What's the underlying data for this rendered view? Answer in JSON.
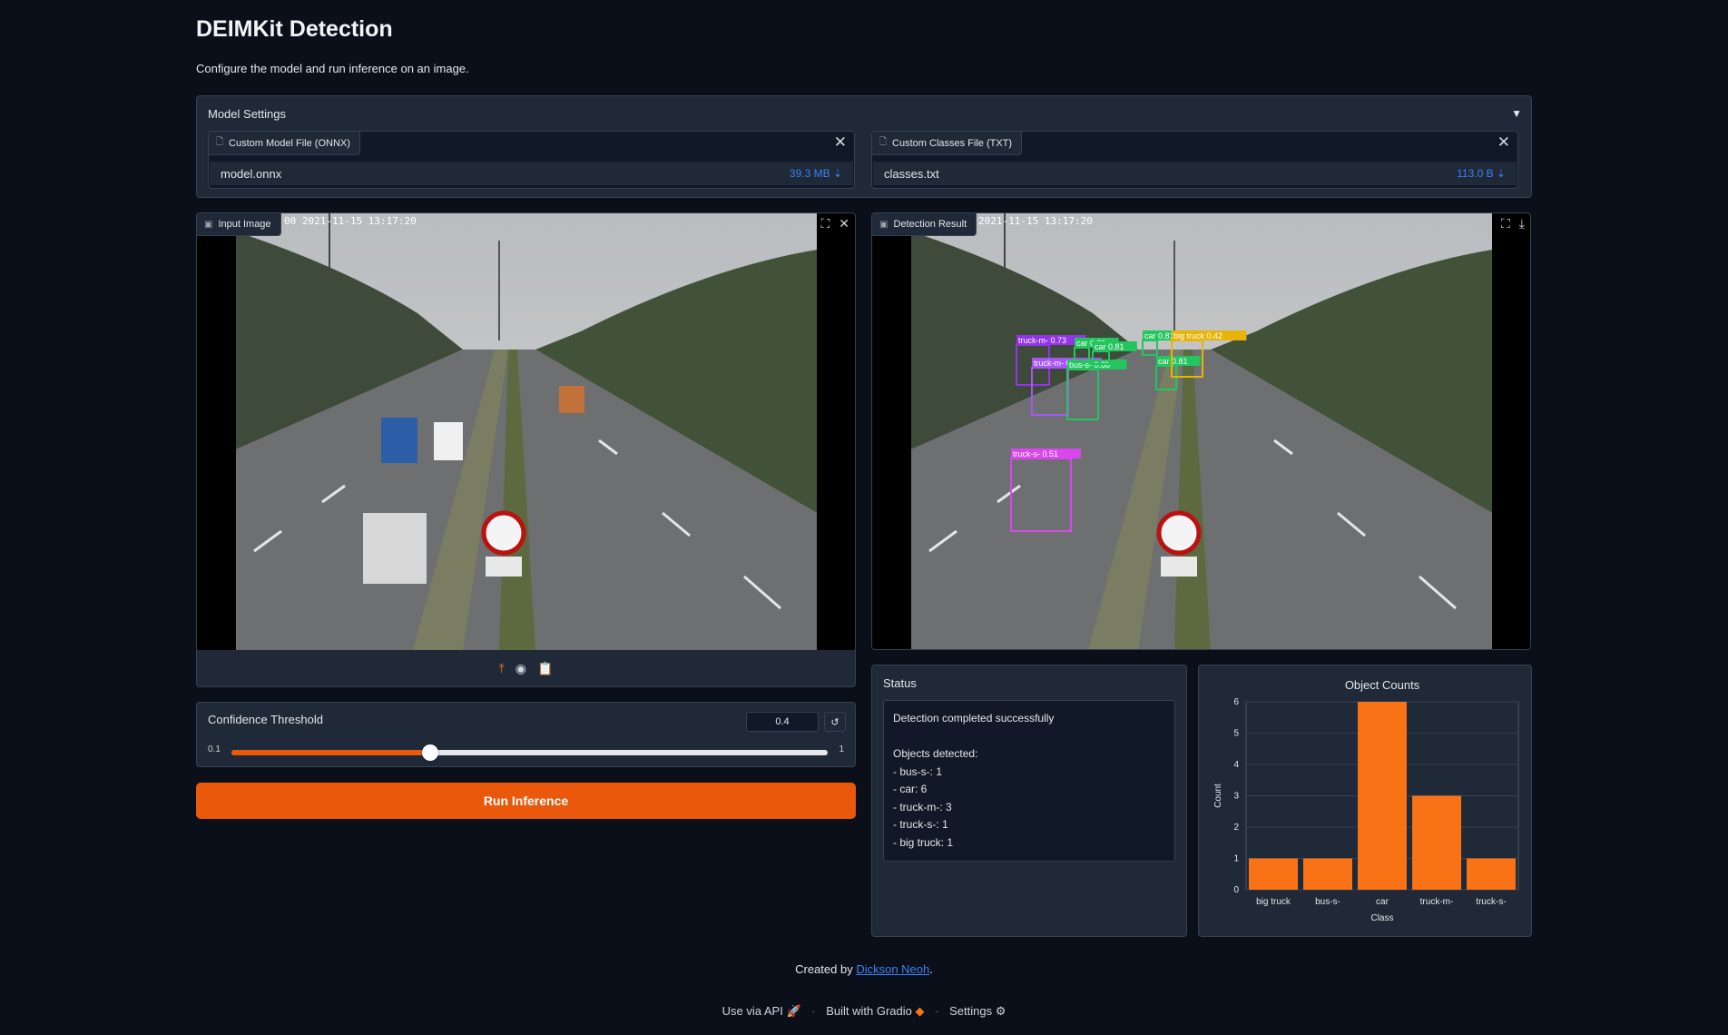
{
  "page": {
    "title": "DEIMKit Detection",
    "subtitle": "Configure the model and run inference on an image."
  },
  "model_settings": {
    "title": "Model Settings",
    "toggle_icon": "▼",
    "model_file": {
      "label": "Custom Model File (ONNX)",
      "name": "model.onnx",
      "size": "39.3 MB ⇣"
    },
    "classes_file": {
      "label": "Custom Classes File (TXT)",
      "name": "classes.txt",
      "size": "113.0 B ⇣"
    }
  },
  "input_image": {
    "label": "Input Image",
    "timestamp": "00 2021-11-15 13:17:20",
    "tools": [
      "fullscreen-icon",
      "close-icon"
    ],
    "sources": [
      "upload-icon",
      "webcam-icon",
      "clipboard-icon"
    ]
  },
  "result_image": {
    "label": "Detection Result",
    "timestamp": "2021-11-15 13:17:20",
    "tools": [
      "fullscreen-icon",
      "download-icon"
    ],
    "detections": [
      {
        "label": "truck-m- 0.73",
        "color": "#9333ea"
      },
      {
        "label": "truck-m- 0.73",
        "color": "#a855f7"
      },
      {
        "label": "bus-s- 0.88",
        "color": "#22c55e"
      },
      {
        "label": "car 0.81",
        "color": "#22c55e"
      },
      {
        "label": "car 0.81",
        "color": "#22c55e"
      },
      {
        "label": "car 0.81",
        "color": "#22c55e"
      },
      {
        "label": "car 0.81",
        "color": "#22c55e"
      },
      {
        "label": "big truck 0.42",
        "color": "#eab308"
      },
      {
        "label": "truck-s- 0.51",
        "color": "#d946ef"
      }
    ]
  },
  "threshold": {
    "label": "Confidence Threshold",
    "value": "0.4",
    "min": "0.1",
    "max": "1",
    "fraction": 0.333,
    "reset_icon": "↺"
  },
  "run_button": {
    "label": "Run Inference",
    "color": "#ea580c"
  },
  "status": {
    "label": "Status",
    "lines": [
      "Detection completed successfully",
      "",
      "Objects detected:",
      "- bus-s-: 1",
      "- car: 6",
      "- truck-m-: 3",
      "- truck-s-: 1",
      "- big truck: 1"
    ]
  },
  "chart_data": {
    "type": "bar",
    "title": "Object Counts",
    "xlabel": "Class",
    "ylabel": "Count",
    "categories": [
      "big truck",
      "bus-s-",
      "car",
      "truck-m-",
      "truck-s-"
    ],
    "values": [
      1,
      1,
      6,
      3,
      1
    ],
    "ylim": [
      0,
      6
    ],
    "yticks": [
      "0",
      "1",
      "2",
      "3",
      "4",
      "5",
      "6"
    ],
    "bar_color": "#f97316",
    "grid": true
  },
  "footer": {
    "created_prefix": "Created by ",
    "author": "Dickson Neoh",
    "created_suffix": ".",
    "api": "Use via API",
    "gradio": "Built with Gradio",
    "settings": "Settings"
  }
}
